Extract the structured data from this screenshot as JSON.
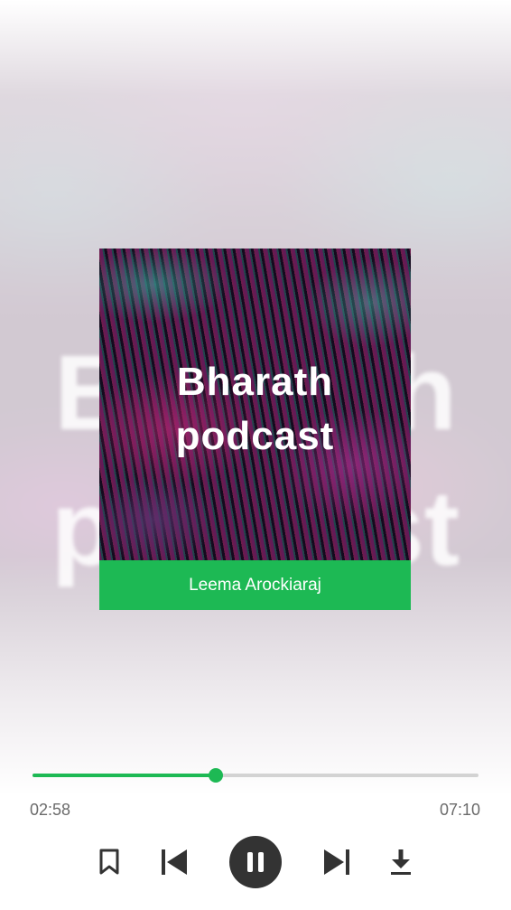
{
  "podcast": {
    "title": "Bharath\npodcast",
    "author": "Leema Arockiaraj"
  },
  "player": {
    "elapsed": "02:58",
    "total": "07:10",
    "progress_fraction": 0.41,
    "state": "playing"
  },
  "controls": {
    "bookmark_icon": "bookmark-icon",
    "previous_icon": "skip-previous-icon",
    "pause_icon": "pause-icon",
    "next_icon": "skip-next-icon",
    "download_icon": "download-icon"
  },
  "colors": {
    "accent": "#1db954",
    "play_button": "#333333",
    "track": "#d3d3d3",
    "time_text": "#6b6b6b"
  }
}
